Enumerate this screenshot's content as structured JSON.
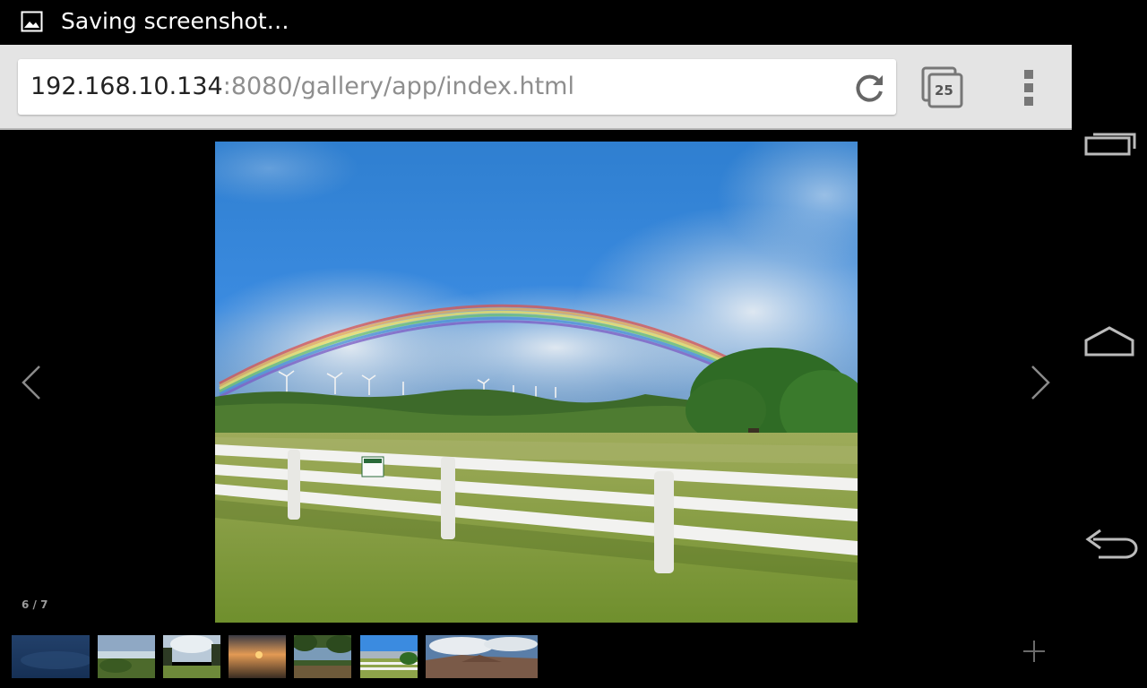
{
  "status_bar": {
    "notification_icon": "image-icon",
    "text": "Saving screenshot…"
  },
  "toolbar": {
    "url_host": "192.168.10.134",
    "url_rest": ":8080/gallery/app/index.html",
    "reload_icon": "reload-icon",
    "tab_count": "25",
    "menu_icon": "overflow-menu-icon"
  },
  "nav_bar": {
    "buttons": [
      "recent-apps-icon",
      "home-icon",
      "back-icon"
    ]
  },
  "gallery": {
    "counter": "6 / 7",
    "prev_icon": "chevron-left-icon",
    "next_icon": "chevron-right-icon",
    "add_icon": "plus-icon",
    "thumbnail_count": 7,
    "selected_index": 6
  }
}
